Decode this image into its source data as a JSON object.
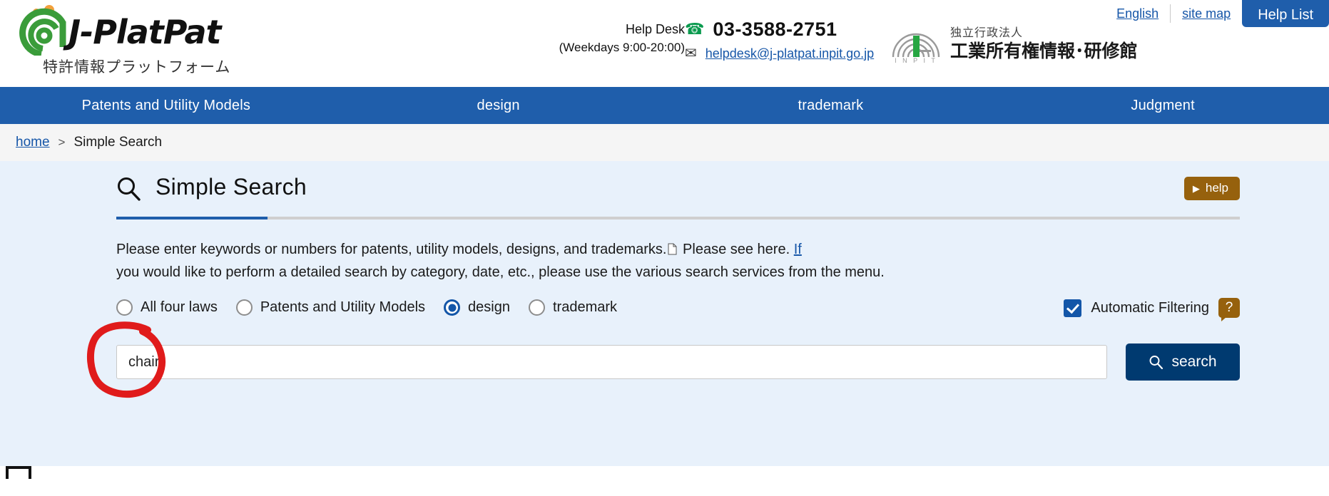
{
  "header": {
    "logo": {
      "wordmark": "J-PlatPat",
      "subtitle": "特許情報プラットフォーム",
      "mark_name": "j-platpat-logo"
    },
    "helpdesk": {
      "label": "Help Desk",
      "hours": "(Weekdays 9:00-20:00)",
      "phone": "03-3588-2751",
      "email": "helpdesk@j-platpat.inpit.go.jp",
      "phone_icon": "phone-icon",
      "mail_icon": "mail-icon"
    },
    "inpit": {
      "line1": "独立行政法人",
      "line2": "工業所有権情報･研修館",
      "mark_label": "I N P I T"
    },
    "top_links": [
      {
        "label": "English"
      },
      {
        "label": "site map"
      }
    ],
    "help_list_button": "Help List"
  },
  "nav": {
    "items": [
      {
        "label": "Patents and Utility Models"
      },
      {
        "label": "design"
      },
      {
        "label": "trademark"
      },
      {
        "label": "Judgment"
      }
    ],
    "background": "#1f5eab"
  },
  "breadcrumb": {
    "home": "home",
    "separator": ">",
    "current": "Simple Search"
  },
  "panel": {
    "title": "Simple Search",
    "title_icon": "search-icon",
    "help_button": {
      "label": "help",
      "icon": "play-triangle-icon",
      "color": "#96610d"
    },
    "description": {
      "part1": "Please enter keywords or numbers for patents, utility models, designs, and trademarks.",
      "doc_icon": "document-icon",
      "part2": "Please see here.",
      "link": "If",
      "line2": "you would like to perform a detailed search by category, date, etc., please use the various search services from the menu."
    },
    "radios": [
      {
        "label": "All four laws",
        "selected": false
      },
      {
        "label": "Patents and Utility Models",
        "selected": false
      },
      {
        "label": "design",
        "selected": true
      },
      {
        "label": "trademark",
        "selected": false
      }
    ],
    "auto_filter": {
      "label": "Automatic Filtering",
      "checked": true,
      "tooltip_icon": "question-mark-icon",
      "tooltip_label": "?"
    },
    "search": {
      "value": "chair",
      "placeholder": "",
      "button_label": "search",
      "button_icon": "search-icon",
      "button_color": "#003a70"
    },
    "annotation": {
      "name": "red-circle-annotation",
      "color": "#e01b1b"
    },
    "background": "#e8f1fb"
  }
}
